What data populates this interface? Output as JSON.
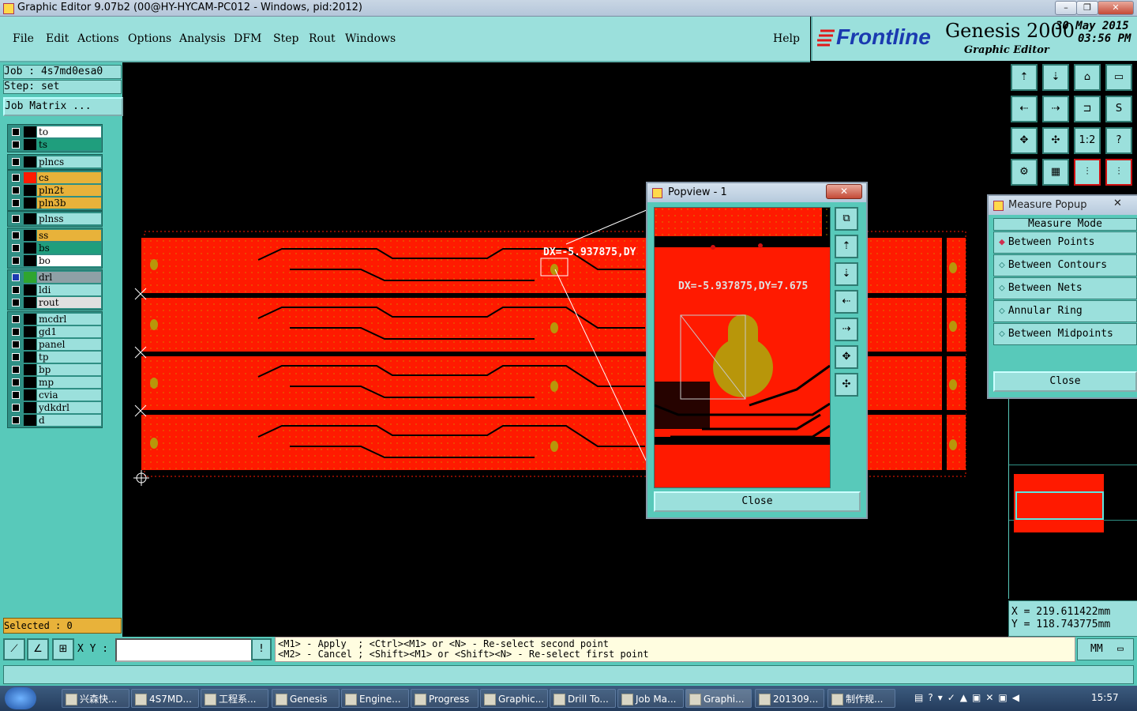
{
  "window": {
    "title": "Graphic Editor 9.07b2 (00@HY-HYCAM-PC012 - Windows, pid:2012)"
  },
  "menu": {
    "items": [
      "File",
      "Edit",
      "Actions",
      "Options",
      "Analysis",
      "DFM",
      "Step",
      "Rout",
      "Windows"
    ],
    "help": "Help"
  },
  "brand": {
    "logo": "Frontline",
    "product": "Genesis 2000",
    "subtitle": "Graphic Editor",
    "date": "30 May 2015",
    "time": "03:56 PM"
  },
  "job": {
    "job_label": "Job : 4s7md0esa0",
    "step_label": "Step: set",
    "matrix_button": "Job Matrix ..."
  },
  "layers": {
    "group1": [
      {
        "name": "to",
        "color": "#ffffff"
      },
      {
        "name": "ts",
        "color": "#1f9e7d"
      }
    ],
    "group2": [
      {
        "name": "plncs",
        "color": "#9be0dc"
      }
    ],
    "group3": [
      {
        "name": "cs",
        "color": "#e8b23a"
      },
      {
        "name": "pln2t",
        "color": "#e8b23a"
      },
      {
        "name": "pln3b",
        "color": "#e8b23a"
      }
    ],
    "group4": [
      {
        "name": "plnss",
        "color": "#9be0dc"
      }
    ],
    "group5": [
      {
        "name": "ss",
        "color": "#e8b23a"
      },
      {
        "name": "bs",
        "color": "#1f9e7d"
      },
      {
        "name": "bo",
        "color": "#ffffff"
      }
    ],
    "group6": [
      {
        "name": "drl",
        "color": "#8fa0a6"
      },
      {
        "name": "ldi",
        "color": "#9be0dc"
      },
      {
        "name": "rout",
        "color": "#e0e0e0"
      }
    ],
    "group7": [
      {
        "name": "mcdrl",
        "color": "#9be0dc"
      },
      {
        "name": "gd1",
        "color": "#9be0dc"
      },
      {
        "name": "panel",
        "color": "#9be0dc"
      },
      {
        "name": "tp",
        "color": "#9be0dc"
      },
      {
        "name": "bp",
        "color": "#9be0dc"
      },
      {
        "name": "mp",
        "color": "#9be0dc"
      },
      {
        "name": "cvia",
        "color": "#9be0dc"
      },
      {
        "name": "ydkdrl",
        "color": "#9be0dc"
      },
      {
        "name": "d",
        "color": "#9be0dc"
      }
    ]
  },
  "selected": "Selected : 0",
  "canvas": {
    "measure_text": "DX=-5.937875,DY"
  },
  "popview": {
    "title": "Popview - 1",
    "measure_text": "DX=-5.937875,DY=7.675",
    "close": "Close"
  },
  "measure_popup": {
    "title": "Measure Popup",
    "mode_label": "Measure Mode",
    "options": [
      "Between Points",
      "Between Contours",
      "Between Nets",
      "Annular Ring",
      "Between Midpoints"
    ],
    "selected": "Between Points",
    "close": "Close"
  },
  "coords": {
    "x": "X  =  219.611422mm",
    "y": "Y  =  118.743775mm"
  },
  "toolbar_right": {
    "one_to_two": "1:2",
    "help": "?"
  },
  "status": {
    "xy_label": "X Y :",
    "xy_value": "",
    "hint1": "<M1> - Apply  ; <Ctrl><M1> or <N> - Re-select second point",
    "hint2": "<M2> - Cancel ; <Shift><M1> or <Shift><N> - Re-select first point",
    "units": "MM",
    "exclaim": "!"
  },
  "taskbar": {
    "items": [
      "兴森快...",
      "4S7MD...",
      "工程系...",
      "Genesis",
      "Engine...",
      "Progress",
      "Graphic...",
      "Drill To...",
      "Job Ma...",
      "Graphi...",
      "201309...",
      "制作规..."
    ],
    "clock": "15:57"
  },
  "colors": {
    "teal": "#58c9ba",
    "light_teal": "#9be0dc",
    "pcb_red": "#ff1a00",
    "pad_gold": "#b8960a"
  }
}
